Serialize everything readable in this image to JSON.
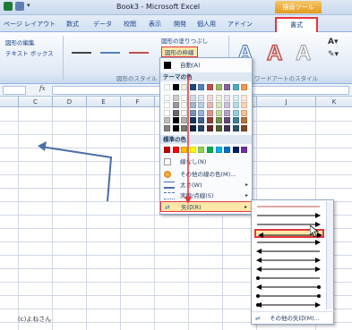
{
  "window": {
    "title": "Book3 - Microsoft Excel",
    "contextual_tab": "描画ツール"
  },
  "tabs": [
    "ページ レイアウト",
    "数式",
    "データ",
    "校閲",
    "表示",
    "開発",
    "個人用",
    "アドイン"
  ],
  "active_tab": "書式",
  "ribbon": {
    "edit_shape": "図形の編集",
    "text_box": "テキスト ボックス",
    "fill": "図形の塗りつぶし",
    "outline": "図形の枠線",
    "shape_styles": "図形のスタイル",
    "wordart_styles": "ワードアートのスタイル",
    "wordart_glyph": "A"
  },
  "formula_bar": {
    "fx": "fx"
  },
  "columns": [
    "C",
    "D",
    "E",
    "F",
    "G",
    "H",
    "I",
    "J",
    "K"
  ],
  "color_menu": {
    "auto": "自動(A)",
    "theme_colors": "テーマの色",
    "standard_colors": "標準の色",
    "no_line": "線なし(N)",
    "more_colors": "その他の線の色(M)...",
    "weight": "太さ(W)",
    "dashes": "実線/点線(S)",
    "arrows": "矢印(R)",
    "theme_top_row": [
      "#ffffff",
      "#000000",
      "#eeece1",
      "#1f497d",
      "#4f81bd",
      "#c0504d",
      "#9bbb59",
      "#8064a2",
      "#4bacc6",
      "#f79646"
    ],
    "standard_row": [
      "#c00000",
      "#ff0000",
      "#ffc000",
      "#ffff00",
      "#92d050",
      "#00b050",
      "#00b0f0",
      "#0070c0",
      "#002060",
      "#7030a0"
    ]
  },
  "arrow_menu": {
    "more": "その他の矢印(M)..."
  },
  "credit": "(c)よねさん",
  "colors": {
    "accent_red": "#e8343a",
    "drawn_arrow": "#4a6fa5"
  }
}
